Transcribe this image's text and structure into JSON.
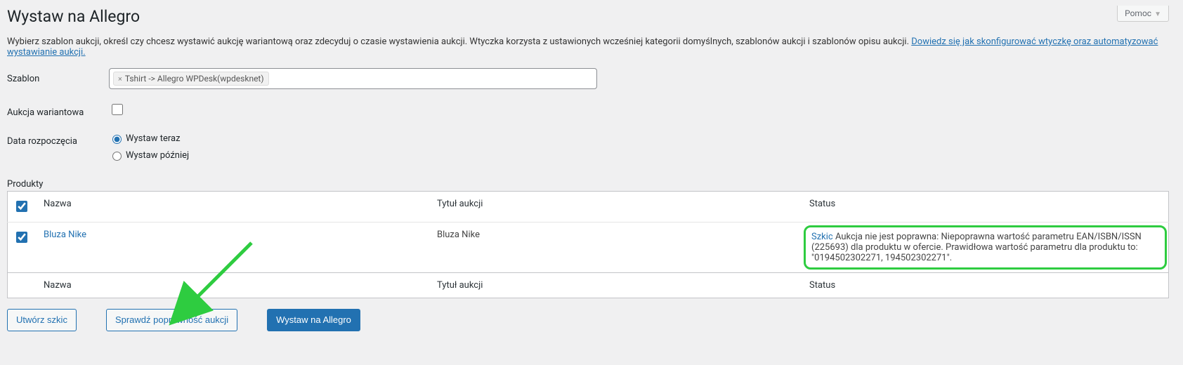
{
  "help_button": "Pomoc",
  "page_title": "Wystaw na Allegro",
  "intro_text": "Wybierz szablon aukcji, określ czy chcesz wystawić aukcję wariantową oraz zdecyduj o czasie wystawienia aukcji. Wtyczka korzysta z ustawionych wcześniej kategorii domyślnych, szablonów aukcji i szablonów opisu aukcji. ",
  "intro_link": "Dowiedz się jak skonfigurować wtyczkę oraz automatyzować wystawianie aukcji.",
  "labels": {
    "template": "Szablon",
    "variant": "Aukcja wariantowa",
    "start_date": "Data rozpoczęcia",
    "products": "Produkty"
  },
  "template_tag": "Tshirt -> Allegro WPDesk(wpdesknet)",
  "radios": {
    "now": "Wystaw teraz",
    "later": "Wystaw później"
  },
  "columns": {
    "name": "Nazwa",
    "title": "Tytuł aukcji",
    "status": "Status"
  },
  "row": {
    "name": "Bluza Nike",
    "title": "Bluza Nike",
    "status_link": "Szkic",
    "status_text": " Aukcja nie jest poprawna: Niepoprawna wartość parametru EAN/ISBN/ISSN (225693) dla produktu w ofercie. Prawidłowa wartość parametru dla produktu to: \"0194502302271, 194502302271\"."
  },
  "buttons": {
    "draft": "Utwórz szkic",
    "check": "Sprawdź poprawność aukcji",
    "publish": "Wystaw na Allegro"
  }
}
